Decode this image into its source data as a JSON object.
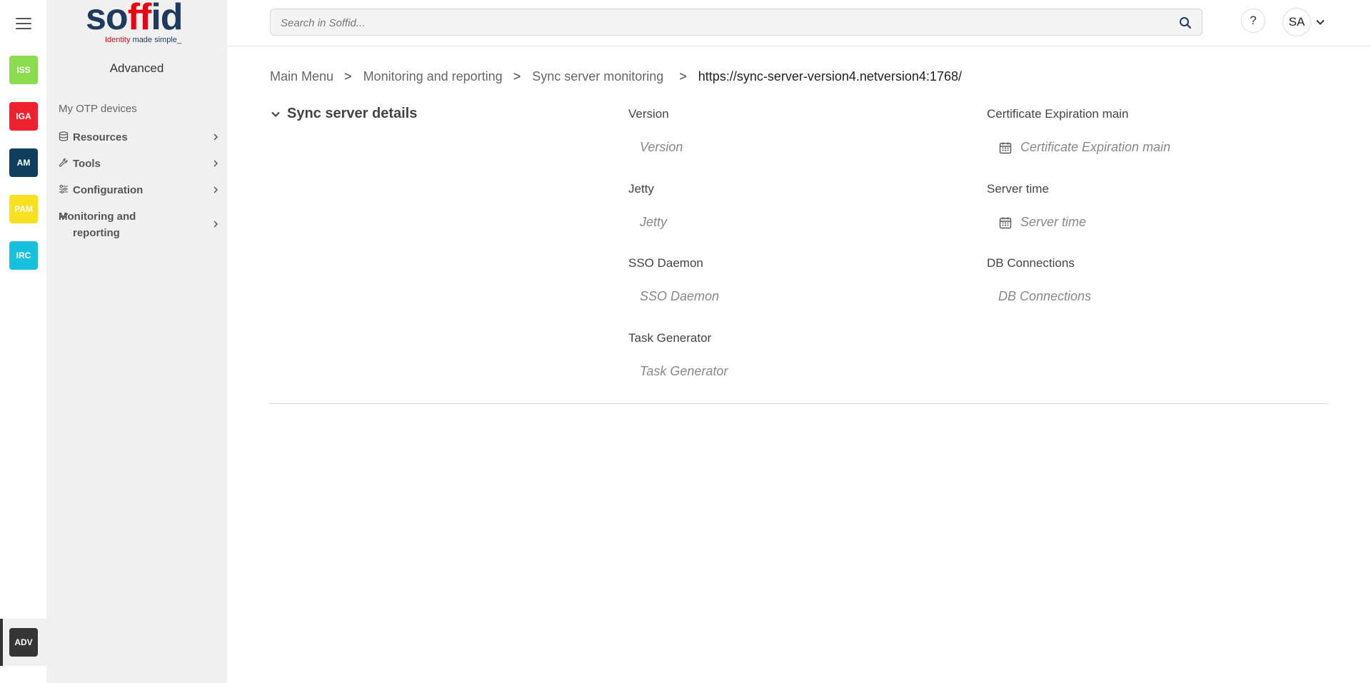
{
  "rail": {
    "apps": [
      {
        "label": "ISS",
        "color": "#8bdc4e"
      },
      {
        "label": "IGA",
        "color": "#f0212e"
      },
      {
        "label": "AM",
        "color": "#0f3d5c"
      },
      {
        "label": "PAM",
        "color": "#f7e120"
      },
      {
        "label": "IRC",
        "color": "#17c0dc"
      },
      {
        "label": "ADV",
        "color": "#353535"
      }
    ]
  },
  "sidebar": {
    "logo": {
      "wordmark": "soffid",
      "tagline_a": "Identity",
      "tagline_b": " made simple_"
    },
    "section_title": "Advanced",
    "plain_item": "My OTP devices",
    "items": [
      {
        "label": "Resources",
        "icon": "database-icon"
      },
      {
        "label": "Tools",
        "icon": "wrench-icon"
      },
      {
        "label": "Configuration",
        "icon": "sliders-icon"
      },
      {
        "label": "Monitoring and reporting",
        "icon": "chart-line-icon"
      }
    ]
  },
  "header": {
    "search_placeholder": "Search in Soffid...",
    "help_label": "?",
    "user_initials": "SA"
  },
  "breadcrumb": {
    "items": [
      "Main Menu",
      "Monitoring and reporting",
      "Sync server monitoring"
    ],
    "separator": ">",
    "current": "https://sync-server-version4.netversion4:1768/"
  },
  "details": {
    "title": "Sync server details",
    "fields": {
      "version": {
        "label": "Version",
        "placeholder": "Version"
      },
      "jetty": {
        "label": "Jetty",
        "placeholder": "Jetty"
      },
      "sso_daemon": {
        "label": "SSO Daemon",
        "placeholder": "SSO Daemon"
      },
      "task_generator": {
        "label": "Task Generator",
        "placeholder": "Task Generator"
      },
      "cert_expiration": {
        "label": "Certificate Expiration main",
        "placeholder": "Certificate Expiration main"
      },
      "server_time": {
        "label": "Server time",
        "placeholder": "Server time"
      },
      "db_connections": {
        "label": "DB Connections",
        "placeholder": "DB Connections"
      }
    }
  }
}
